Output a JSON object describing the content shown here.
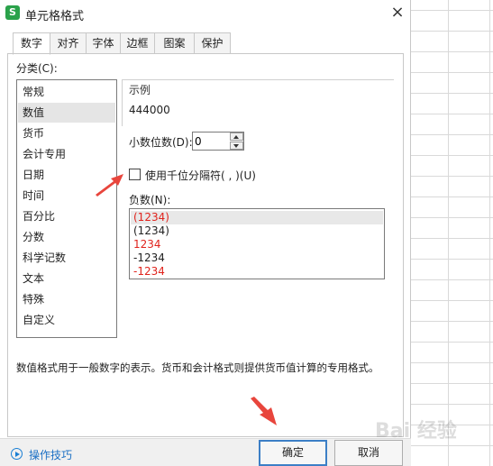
{
  "dialog": {
    "title": "单元格格式",
    "close_glyph": "×",
    "app_icon_letter": "S"
  },
  "tabs": [
    {
      "label": "数字",
      "active": true
    },
    {
      "label": "对齐",
      "active": false
    },
    {
      "label": "字体",
      "active": false
    },
    {
      "label": "边框",
      "active": false
    },
    {
      "label": "图案",
      "active": false
    },
    {
      "label": "保护",
      "active": false
    }
  ],
  "category": {
    "label": "分类(C):",
    "items": [
      "常规",
      "数值",
      "货币",
      "会计专用",
      "日期",
      "时间",
      "百分比",
      "分数",
      "科学记数",
      "文本",
      "特殊",
      "自定义"
    ],
    "selected": "数值"
  },
  "sample": {
    "legend": "示例",
    "value": "444000"
  },
  "decimal": {
    "label": "小数位数(D):",
    "value": "0"
  },
  "thousand_separator": {
    "label": "使用千位分隔符( , )(U)",
    "checked": false
  },
  "negative": {
    "label": "负数(N):",
    "items": [
      {
        "text": "(1234)",
        "color": "#e0231c",
        "selected": true
      },
      {
        "text": "(1234)",
        "color": "#222222",
        "selected": false
      },
      {
        "text": "1234",
        "color": "#e0231c",
        "selected": false
      },
      {
        "text": "-1234",
        "color": "#222222",
        "selected": false
      },
      {
        "text": "-1234",
        "color": "#e0231c",
        "selected": false
      }
    ]
  },
  "description": "数值格式用于一般数字的表示。货币和会计格式则提供货币值计算的专用格式。",
  "footer": {
    "tips_label": "操作技巧",
    "ok_label": "确定",
    "cancel_label": "取消"
  },
  "watermark": "Bai 经验",
  "colors": {
    "accent": "#3c7fc6",
    "annotation_arrow": "#e8453c",
    "negative_red": "#e0231c"
  }
}
